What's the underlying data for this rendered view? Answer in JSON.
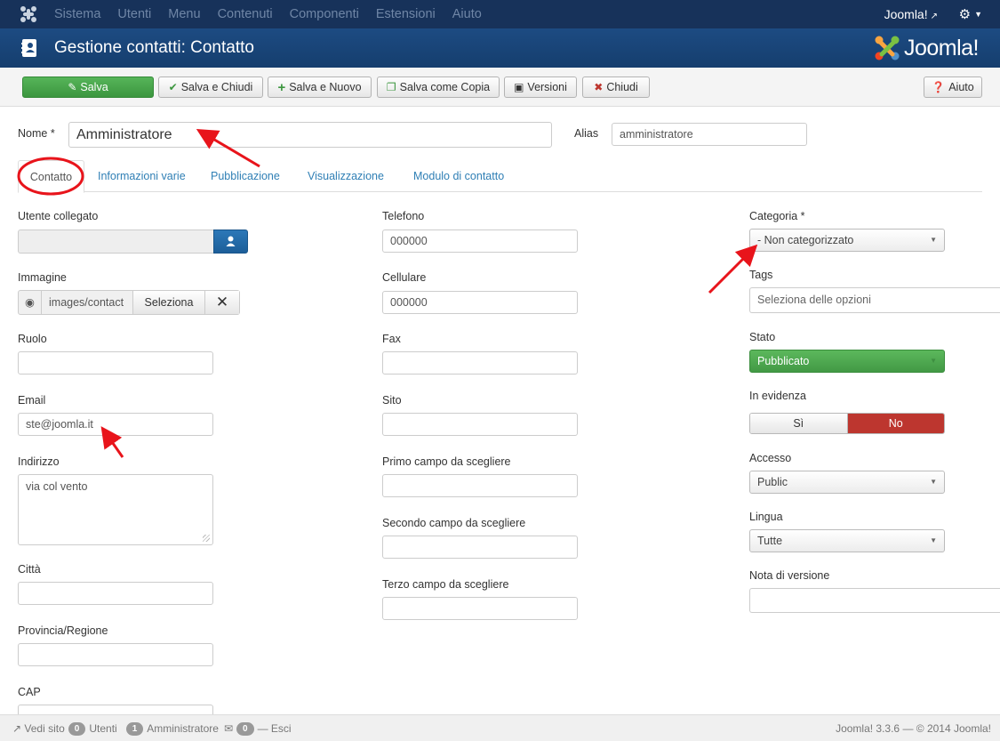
{
  "navbar": {
    "menu": [
      "Sistema",
      "Utenti",
      "Menu",
      "Contenuti",
      "Componenti",
      "Estensioni",
      "Aiuto"
    ],
    "site_link": "Joomla!"
  },
  "header": {
    "title": "Gestione contatti: Contatto",
    "brand": "Joomla!"
  },
  "toolbar": {
    "save": "Salva",
    "save_close": "Salva e Chiudi",
    "save_new": "Salva e Nuovo",
    "save_copy": "Salva come Copia",
    "versions": "Versioni",
    "close": "Chiudi",
    "help": "Aiuto"
  },
  "form": {
    "name_label": "Nome *",
    "name_value": "Amministratore",
    "alias_label": "Alias",
    "alias_value": "amministratore"
  },
  "tabs": [
    "Contatto",
    "Informazioni varie",
    "Pubblicazione",
    "Visualizzazione",
    "Modulo di contatto"
  ],
  "left": {
    "linked_user_label": "Utente collegato",
    "image_label": "Immagine",
    "image_path": "images/contact",
    "image_select": "Seleziona",
    "role_label": "Ruolo",
    "email_label": "Email",
    "email_value": "ste@joomla.it",
    "address_label": "Indirizzo",
    "address_value": "via col vento",
    "city_label": "Città",
    "province_label": "Provincia/Regione",
    "zip_label": "CAP"
  },
  "middle": {
    "phone_label": "Telefono",
    "phone_value": "000000",
    "mobile_label": "Cellulare",
    "mobile_value": "000000",
    "fax_label": "Fax",
    "site_label": "Sito",
    "field1_label": "Primo campo da scegliere",
    "field2_label": "Secondo campo da scegliere",
    "field3_label": "Terzo campo da scegliere"
  },
  "right": {
    "category_label": "Categoria *",
    "category_value": "- Non categorizzato",
    "tags_label": "Tags",
    "tags_placeholder": "Seleziona delle opzioni",
    "status_label": "Stato",
    "status_value": "Pubblicato",
    "featured_label": "In evidenza",
    "featured_yes": "Sì",
    "featured_no": "No",
    "access_label": "Accesso",
    "access_value": "Public",
    "language_label": "Lingua",
    "language_value": "Tutte",
    "version_note_label": "Nota di versione"
  },
  "statusbar": {
    "view_site": "Vedi sito",
    "users_count": "0",
    "users_label": "Utenti",
    "admins_count": "1",
    "admins_label": "Amministratore",
    "messages_count": "0",
    "logout": "Esci",
    "version": "Joomla! 3.3.6 — © 2014 Joomla!"
  },
  "colors": {
    "navbar": "#17325a",
    "header": "#1d4b82",
    "save_green": "#46a546",
    "link_blue": "#2f7fb5",
    "no_red": "#bd362f",
    "annotation_red": "#e8141b"
  }
}
